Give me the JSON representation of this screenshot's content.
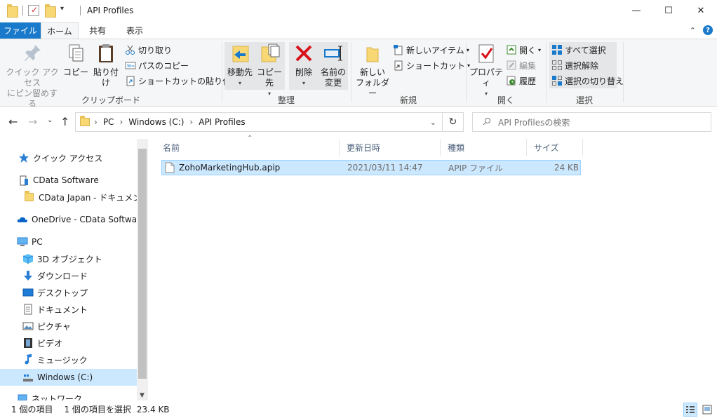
{
  "window": {
    "title": "API Profiles",
    "minimize": "—",
    "maximize": "☐",
    "close": "✕"
  },
  "tabs": {
    "file": "ファイル",
    "home": "ホーム",
    "share": "共有",
    "view": "表示"
  },
  "ribbon": {
    "clipboard": {
      "label": "クリップボード",
      "pin_line1": "クイック アクセス",
      "pin_line2": "にピン留めする",
      "copy": "コピー",
      "paste": "貼り付け",
      "cut": "切り取り",
      "copy_path": "パスのコピー",
      "paste_shortcut": "ショートカットの貼り付け"
    },
    "organize": {
      "label": "整理",
      "move_to": "移動先",
      "copy_to": "コピー先",
      "delete": "削除",
      "rename_line1": "名前の",
      "rename_line2": "変更"
    },
    "new": {
      "label": "新規",
      "new_folder_line1": "新しい",
      "new_folder_line2": "フォルダー",
      "new_item": "新しいアイテム",
      "shortcut": "ショートカット"
    },
    "open": {
      "label": "開く",
      "properties": "プロパティ",
      "open": "開く",
      "edit": "編集",
      "history": "履歴"
    },
    "select": {
      "label": "選択",
      "select_all": "すべて選択",
      "select_none": "選択解除",
      "invert": "選択の切り替え"
    }
  },
  "address": {
    "crumbs": [
      "PC",
      "Windows (C:)",
      "API Profiles"
    ],
    "search_placeholder": "API Profilesの検索"
  },
  "nav": {
    "quick_access": "クイック アクセス",
    "cdata_software": "CData Software",
    "cdata_japan": "CData Japan - ドキュメント",
    "onedrive": "OneDrive - CData Software",
    "pc": "PC",
    "objects_3d": "3D オブジェクト",
    "downloads": "ダウンロード",
    "desktop": "デスクトップ",
    "documents": "ドキュメント",
    "pictures": "ピクチャ",
    "videos": "ビデオ",
    "music": "ミュージック",
    "windows_c": "Windows (C:)",
    "network": "ネットワーク"
  },
  "list": {
    "columns": {
      "name": "名前",
      "modified": "更新日時",
      "type": "種類",
      "size": "サイズ"
    },
    "files": [
      {
        "name": "ZohoMarketingHub.apip",
        "modified": "2021/03/11 14:47",
        "type": "APIP ファイル",
        "size": "24 KB"
      }
    ]
  },
  "status": {
    "item_count": "1 個の項目",
    "selected": "1 個の項目を選択",
    "selected_size": "23.4 KB"
  },
  "colors": {
    "accent": "#1979ca",
    "selection": "#cce8ff",
    "selection_border": "#99d1ff",
    "folder": "#f8d775"
  }
}
